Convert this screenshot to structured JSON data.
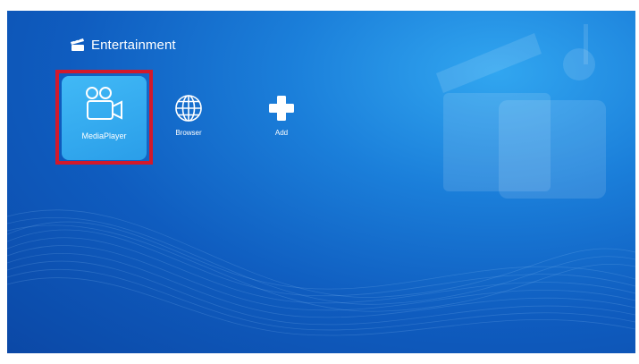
{
  "section": {
    "title": "Entertainment",
    "icon": "clapperboard-icon"
  },
  "apps": [
    {
      "label": "MediaPlayer",
      "icon": "video-camera-icon",
      "selected": true
    },
    {
      "label": "Browser",
      "icon": "globe-icon",
      "selected": false
    },
    {
      "label": "Add",
      "icon": "plus-icon",
      "selected": false
    }
  ],
  "colors": {
    "background_top": "#31a6f0",
    "background_bottom": "#0b48a6",
    "selected_tile": "#2a9ee9",
    "focus_frame": "#d3192b"
  }
}
